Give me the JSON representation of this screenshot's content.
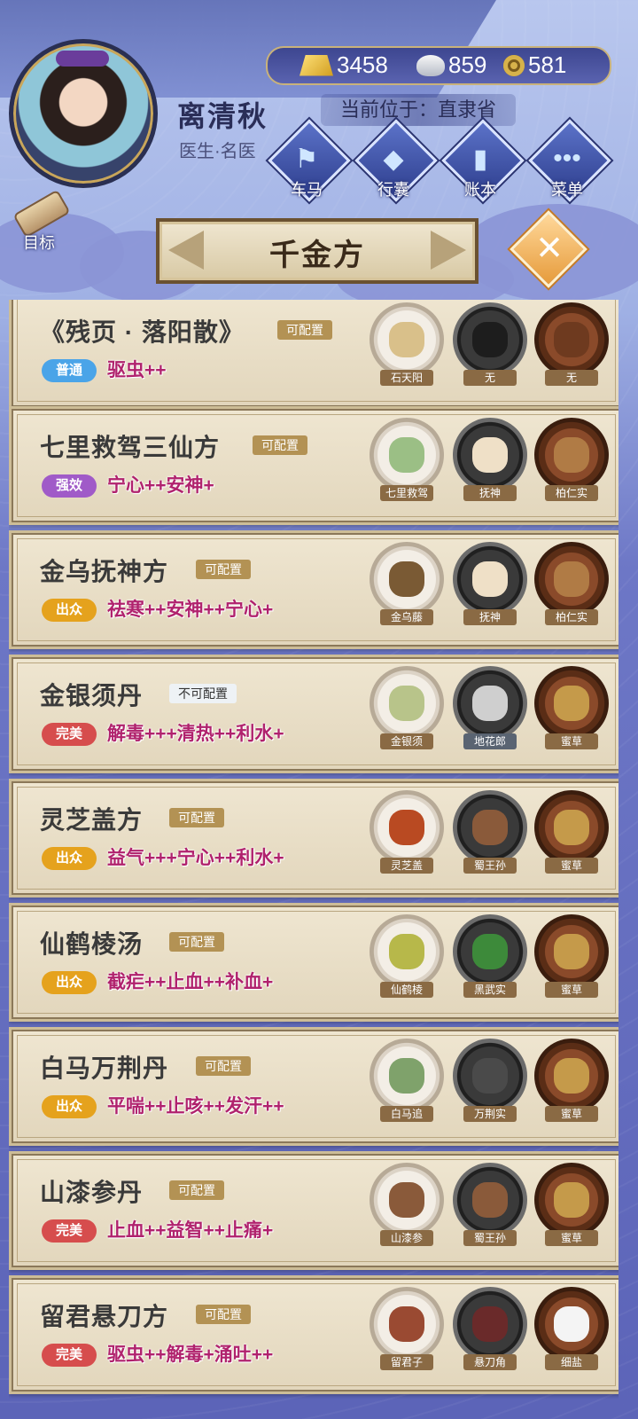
{
  "player": {
    "name": "离清秋",
    "title": "医生·名医"
  },
  "currency": {
    "gold": "3458",
    "silver": "859",
    "coin": "581"
  },
  "location": "当前位于：直隶省",
  "nav": {
    "cart": "车马",
    "bag": "行囊",
    "ledger": "账本",
    "menu": "菜单"
  },
  "goal_label": "目标",
  "banner_title": "千金方",
  "recipes": [
    {
      "name": "《残页 · 落阳散》",
      "config": "可配置",
      "grade": "普通",
      "grade_class": "g-common",
      "effects": "驱虫++",
      "ingredients": [
        {
          "label": "石天阳",
          "plate": "white",
          "color": "#d9c08a"
        },
        {
          "label": "无",
          "plate": "black",
          "color": "#1d1d1d"
        },
        {
          "label": "无",
          "plate": "bowl",
          "color": "#6e3a1f"
        }
      ]
    },
    {
      "name": "七里救驾三仙方",
      "config": "可配置",
      "grade": "强效",
      "grade_class": "g-strong",
      "effects": "宁心++安神+",
      "ingredients": [
        {
          "label": "七里救驾",
          "plate": "white",
          "color": "#9bbf85"
        },
        {
          "label": "抚神",
          "plate": "black",
          "color": "#efe0c7"
        },
        {
          "label": "柏仁实",
          "plate": "bowl",
          "color": "#b07b45"
        }
      ]
    },
    {
      "name": "金乌抚神方",
      "config": "可配置",
      "grade": "出众",
      "grade_class": "g-great",
      "effects": "祛寒++安神++宁心+",
      "ingredients": [
        {
          "label": "金乌藤",
          "plate": "white",
          "color": "#7a5a34"
        },
        {
          "label": "抚神",
          "plate": "black",
          "color": "#efe0c7"
        },
        {
          "label": "柏仁实",
          "plate": "bowl",
          "color": "#b07b45"
        }
      ]
    },
    {
      "name": "金银须丹",
      "config": "不可配置",
      "grade": "完美",
      "grade_class": "g-perfect",
      "effects": "解毒+++清热++利水+",
      "ingredients": [
        {
          "label": "金银须",
          "plate": "white",
          "color": "#b8c48a"
        },
        {
          "label": "地花郎",
          "plate": "black",
          "color": "#cfcfcf"
        },
        {
          "label": "蜜草",
          "plate": "bowl",
          "color": "#c59a4a"
        }
      ]
    },
    {
      "name": "灵芝盖方",
      "config": "可配置",
      "grade": "出众",
      "grade_class": "g-great",
      "effects": "益气+++宁心++利水+",
      "ingredients": [
        {
          "label": "灵芝盖",
          "plate": "white",
          "color": "#b94a22"
        },
        {
          "label": "蜀王孙",
          "plate": "black",
          "color": "#8a5a3a"
        },
        {
          "label": "蜜草",
          "plate": "bowl",
          "color": "#c59a4a"
        }
      ]
    },
    {
      "name": "仙鹤棱汤",
      "config": "可配置",
      "grade": "出众",
      "grade_class": "g-great",
      "effects": "截疟++止血++补血+",
      "ingredients": [
        {
          "label": "仙鹤棱",
          "plate": "white",
          "color": "#b7b84a"
        },
        {
          "label": "黑武实",
          "plate": "black",
          "color": "#3d8a3a"
        },
        {
          "label": "蜜草",
          "plate": "bowl",
          "color": "#c59a4a"
        }
      ]
    },
    {
      "name": "白马万荆丹",
      "config": "可配置",
      "grade": "出众",
      "grade_class": "g-great",
      "effects": "平喘++止咳++发汗++",
      "ingredients": [
        {
          "label": "白马追",
          "plate": "white",
          "color": "#7fa26b"
        },
        {
          "label": "万荆实",
          "plate": "black",
          "color": "#4a4a4a"
        },
        {
          "label": "蜜草",
          "plate": "bowl",
          "color": "#c59a4a"
        }
      ]
    },
    {
      "name": "山漆参丹",
      "config": "可配置",
      "grade": "完美",
      "grade_class": "g-perfect",
      "effects": "止血++益智++止痛+",
      "ingredients": [
        {
          "label": "山漆参",
          "plate": "white",
          "color": "#8a5a3a"
        },
        {
          "label": "蜀王孙",
          "plate": "black",
          "color": "#8a5a3a"
        },
        {
          "label": "蜜草",
          "plate": "bowl",
          "color": "#c59a4a"
        }
      ]
    },
    {
      "name": "留君悬刀方",
      "config": "可配置",
      "grade": "完美",
      "grade_class": "g-perfect",
      "effects": "驱虫++解毒+涌吐++",
      "ingredients": [
        {
          "label": "留君子",
          "plate": "white",
          "color": "#9a4a32"
        },
        {
          "label": "悬刀角",
          "plate": "black",
          "color": "#6a2a2a"
        },
        {
          "label": "细盐",
          "plate": "bowl",
          "color": "#f4f4f4"
        }
      ]
    }
  ]
}
